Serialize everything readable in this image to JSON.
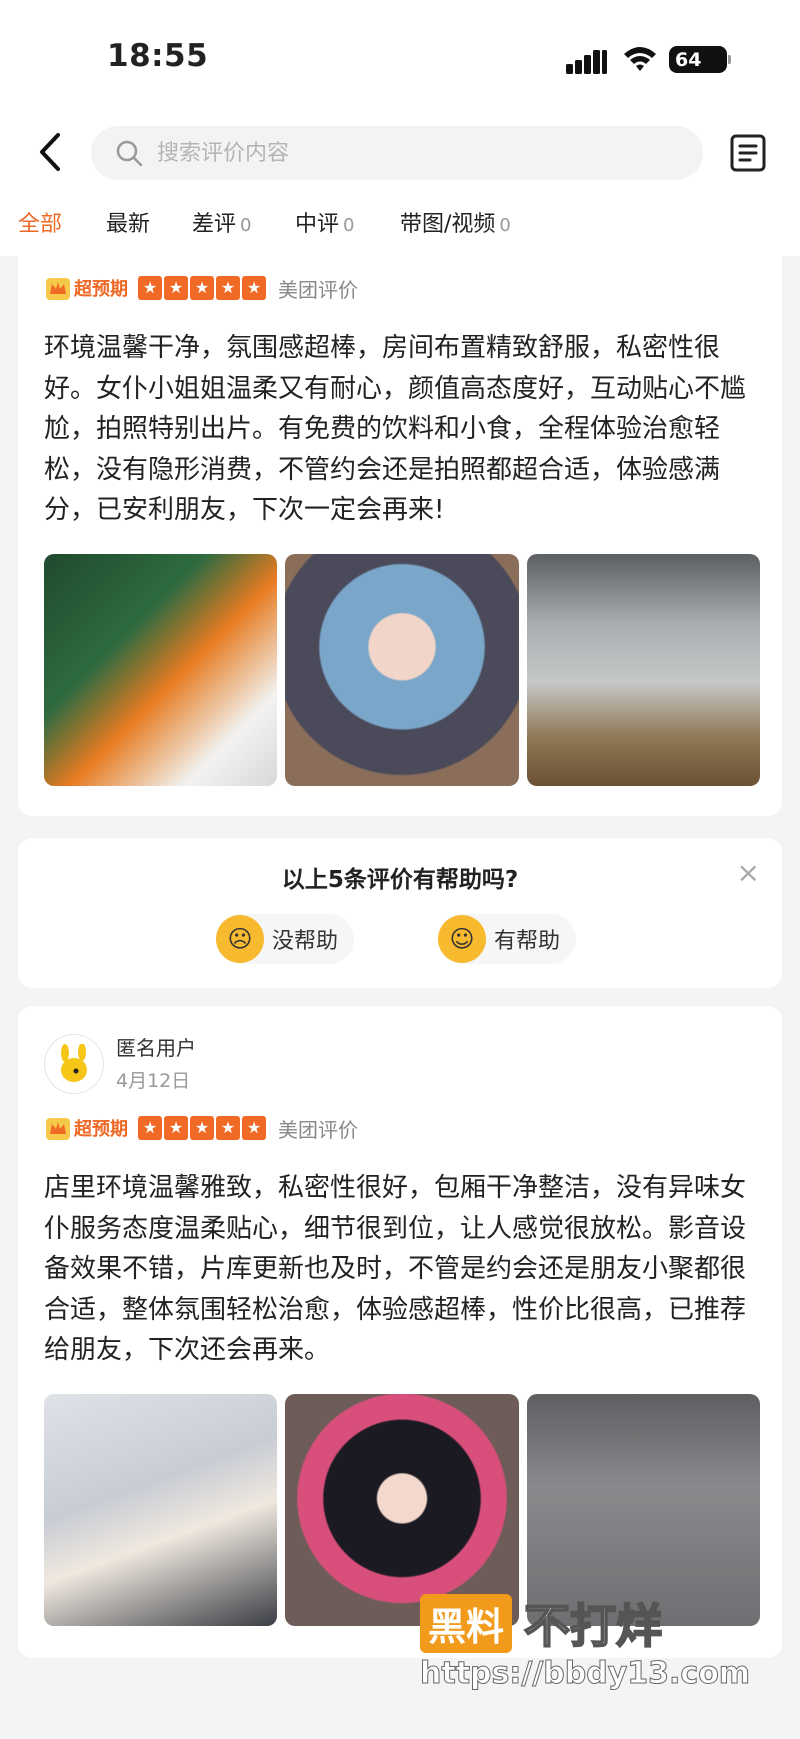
{
  "status": {
    "time": "18:55",
    "battery": "64"
  },
  "header": {
    "search_placeholder": "搜索评价内容"
  },
  "tabs": [
    {
      "label": "全部",
      "count": ""
    },
    {
      "label": "最新",
      "count": ""
    },
    {
      "label": "差评",
      "count": "0"
    },
    {
      "label": "中评",
      "count": "0"
    },
    {
      "label": "带图/视频",
      "count": "0"
    }
  ],
  "review1": {
    "badge": "超预期",
    "source": "美团评价",
    "text": "环境温馨干净，氛围感超棒，房间布置精致舒服，私密性很好。女仆小姐姐温柔又有耐心，颜值高态度好，互动贴心不尴尬，拍照特别出片。有免费的饮料和小食，全程体验治愈轻松，没有隐形消费，不管约会还是拍照都超合适，体验感满分，已安利朋友，下次一定会再来!"
  },
  "helpful": {
    "question": "以上5条评价有帮助吗?",
    "no_label": "没帮助",
    "yes_label": "有帮助"
  },
  "review2": {
    "user": "匿名用户",
    "date": "4月12日",
    "badge": "超预期",
    "source": "美团评价",
    "text": "店里环境温馨雅致，私密性很好，包厢干净整洁，没有异味女仆服务态度温柔贴心，细节很到位，让人感觉很放松。影音设备效果不错，片库更新也及时，不管是约会还是朋友小聚都很合适，整体氛围轻松治愈，体验感超棒，性价比很高，已推荐给朋友，下次还会再来。"
  },
  "watermark": {
    "brand": "黑料",
    "slogan": "不打烊",
    "url": "https://bbdy13.com"
  },
  "colors": {
    "accent": "#f06a26",
    "background": "#f4f4f4"
  },
  "icons": [
    "back-arrow-icon",
    "search-icon",
    "document-icon",
    "crown-icon",
    "star-icon",
    "close-icon"
  ]
}
